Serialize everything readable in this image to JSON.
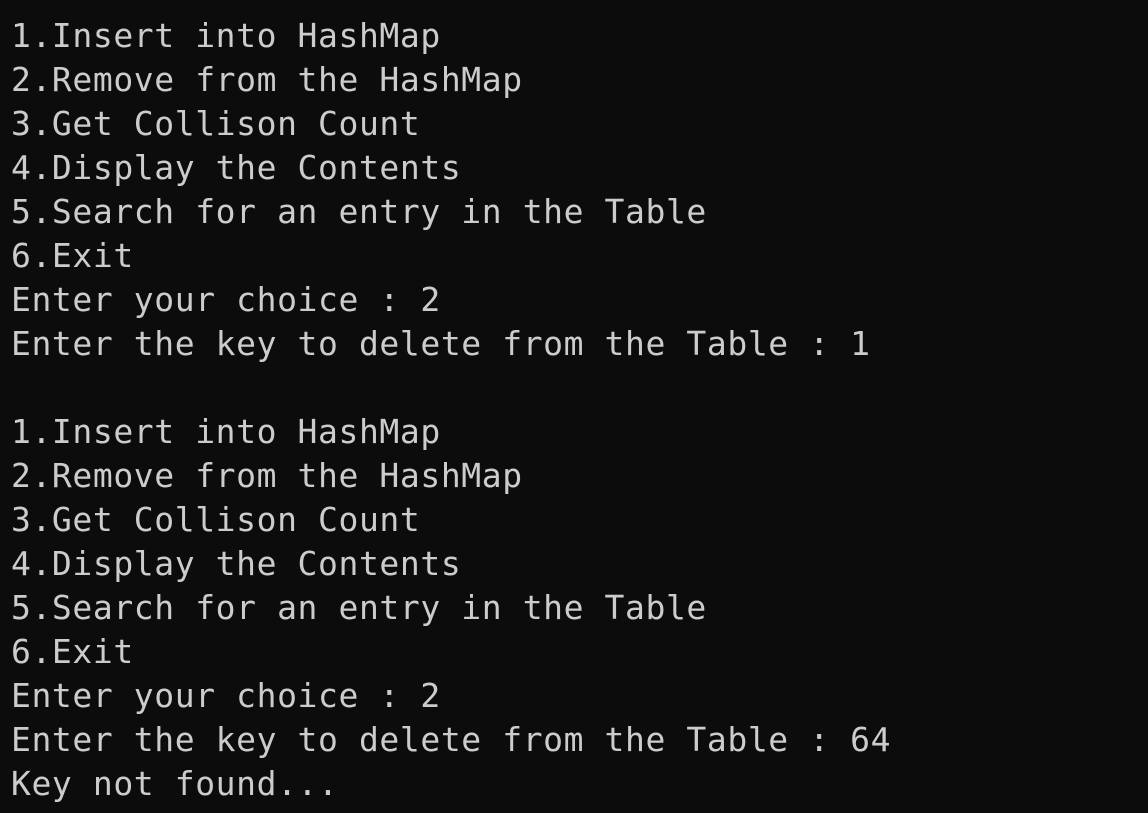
{
  "terminal": {
    "background": "#0c0c0c",
    "foreground": "#cccccc",
    "lines": [
      "1.Insert into HashMap",
      "2.Remove from the HashMap",
      "3.Get Collison Count",
      "4.Display the Contents",
      "5.Search for an entry in the Table",
      "6.Exit",
      "Enter your choice : 2",
      "Enter the key to delete from the Table : 1",
      "",
      "1.Insert into HashMap",
      "2.Remove from the HashMap",
      "3.Get Collison Count",
      "4.Display the Contents",
      "5.Search for an entry in the Table",
      "6.Exit",
      "Enter your choice : 2",
      "Enter the key to delete from the Table : 64",
      "Key not found..."
    ]
  }
}
